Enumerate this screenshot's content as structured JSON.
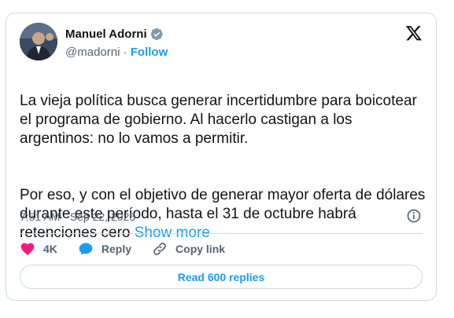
{
  "author": {
    "name": "Manuel Adorni",
    "handle": "@madorni",
    "separator": "·",
    "follow_label": "Follow"
  },
  "post": {
    "text_p1": "La vieja política busca generar incertidumbre para boicotear el programa de gobierno. Al hacerlo castigan a los argentinos: no lo vamos a permitir.",
    "text_p2": "Por eso, y con el objetivo de generar mayor oferta de dólares durante este período, hasta el 31 de octubre habrá retenciones cero ",
    "show_more": "Show more",
    "timestamp": "7:51 AM · Sep 22, 2025"
  },
  "actions": {
    "likes": "4K",
    "reply_label": "Reply",
    "copy_link_label": "Copy link"
  },
  "read_replies_label": "Read 600 replies",
  "colors": {
    "accent": "#1d9bf0",
    "like": "#f91880",
    "verified": "#829aab"
  },
  "icons": [
    "verified-badge-icon",
    "x-logo-icon",
    "info-icon",
    "heart-icon",
    "reply-bubble-icon",
    "link-icon"
  ]
}
